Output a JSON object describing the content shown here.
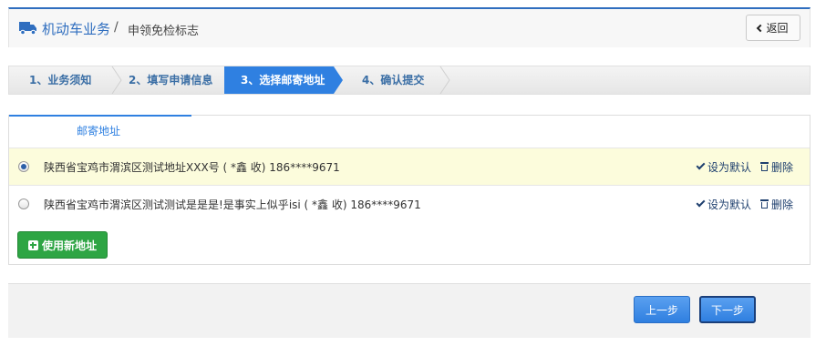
{
  "header": {
    "main_title": "机动车业务",
    "separator": "/",
    "sub_title": "申领免检标志",
    "back_label": "返回",
    "accent_color": "#2f6ebf"
  },
  "steps": [
    {
      "label": "1、业务须知",
      "active": false
    },
    {
      "label": "2、填写申请信息",
      "active": false
    },
    {
      "label": "3、选择邮寄地址",
      "active": true
    },
    {
      "label": "4、确认提交",
      "active": false
    }
  ],
  "address_panel": {
    "tab_label": "邮寄地址",
    "addresses": [
      {
        "text": "陕西省宝鸡市渭滨区测试地址XXX号 ( *鑫 收)   186****9671",
        "selected": true
      },
      {
        "text": "陕西省宝鸡市渭滨区测试测试是是是!是事实上似乎isi ( *鑫 收)   186****9671",
        "selected": false
      }
    ],
    "set_default_label": "设为默认",
    "delete_label": "删除",
    "new_address_label": "使用新地址"
  },
  "footer": {
    "prev_label": "上一步",
    "next_label": "下一步"
  },
  "colors": {
    "active_step": "#2f80e1",
    "selected_row": "#fcfcdc",
    "green_button": "#2ea544"
  }
}
